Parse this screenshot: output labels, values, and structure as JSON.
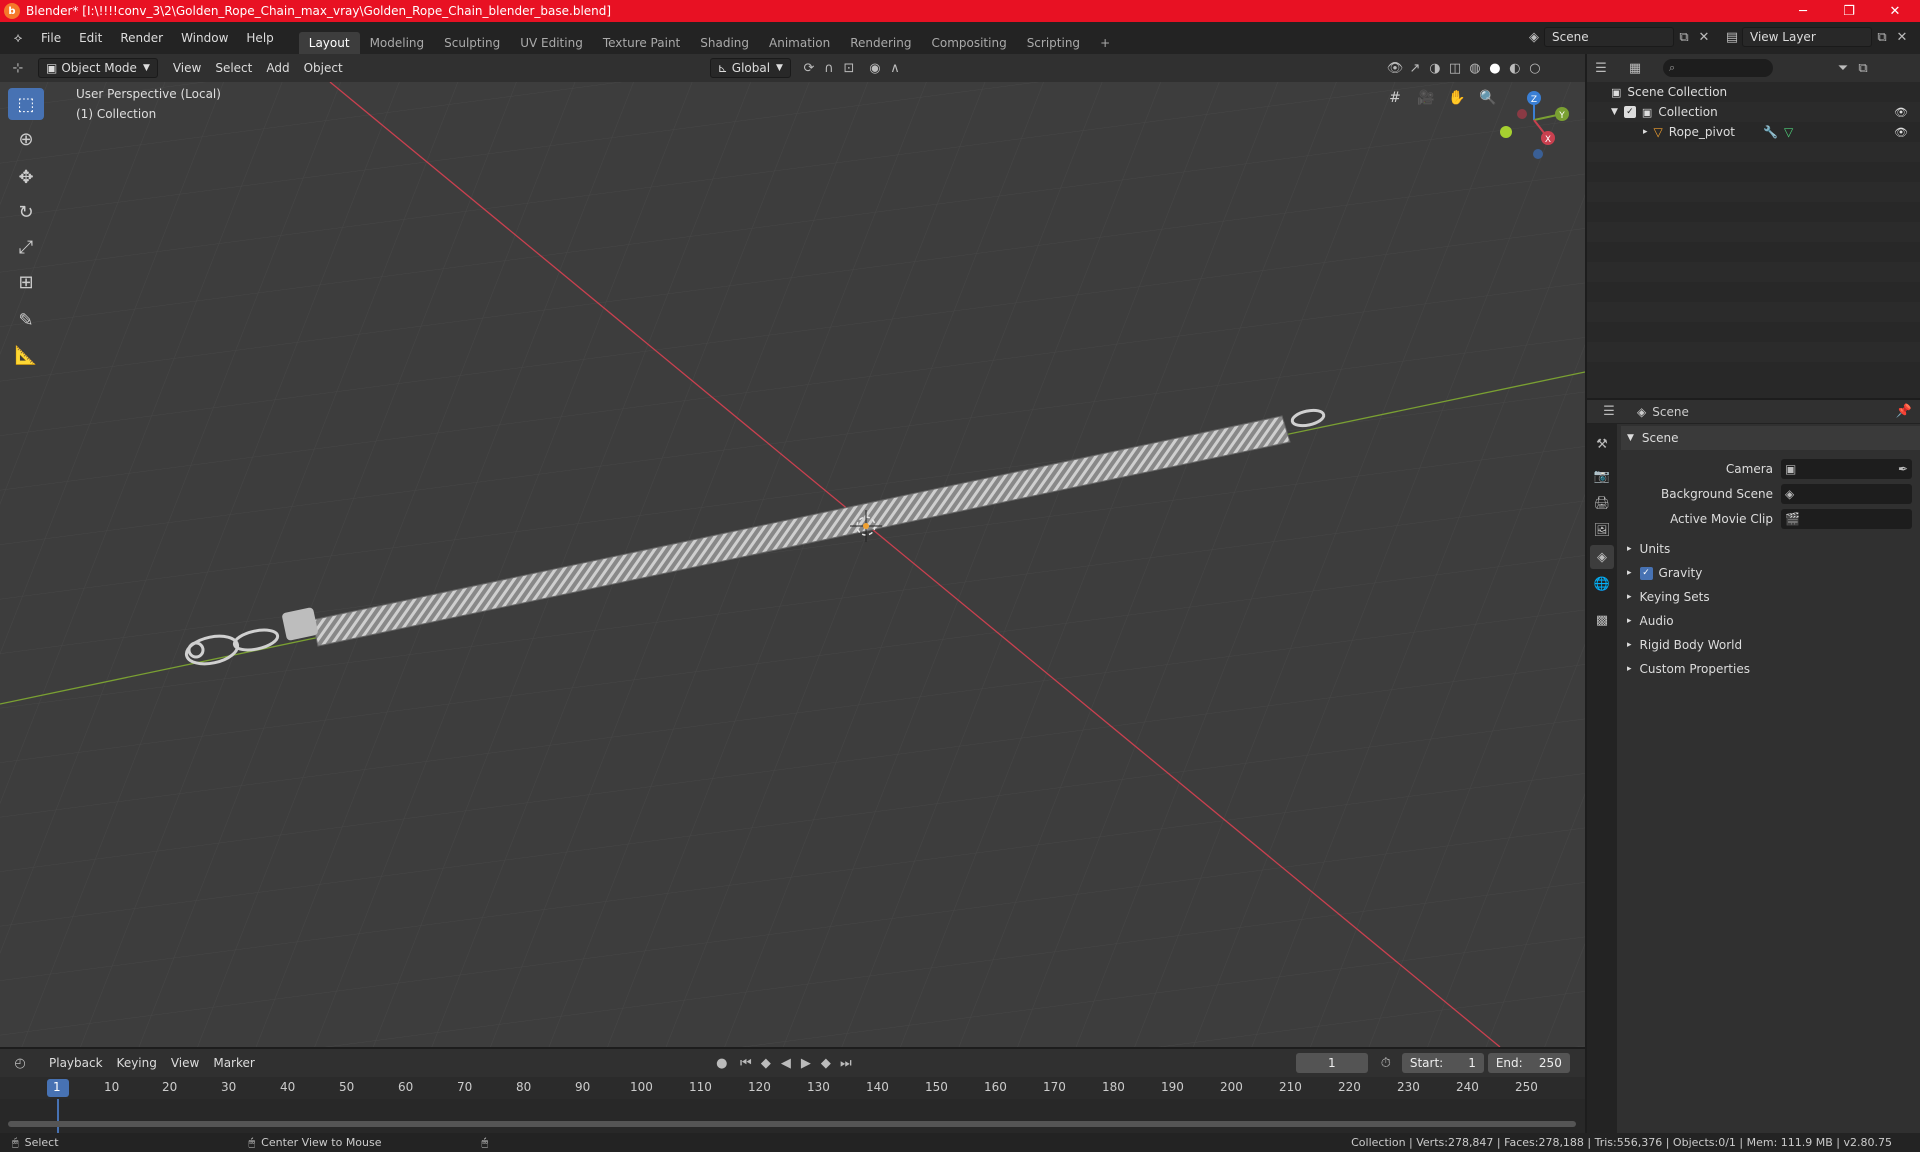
{
  "window": {
    "title": "Blender* [I:\\!!!!conv_3\\2\\Golden_Rope_Chain_max_vray\\Golden_Rope_Chain_blender_base.blend]",
    "controls": {
      "minimize": "─",
      "maximize": "❐",
      "close": "✕"
    }
  },
  "menu": {
    "items": [
      "File",
      "Edit",
      "Render",
      "Window",
      "Help"
    ]
  },
  "workspaces": {
    "tabs": [
      "Layout",
      "Modeling",
      "Sculpting",
      "UV Editing",
      "Texture Paint",
      "Shading",
      "Animation",
      "Rendering",
      "Compositing",
      "Scripting"
    ],
    "active": "Layout",
    "add": "+"
  },
  "scene_selector": {
    "value": "Scene"
  },
  "view_layer_selector": {
    "value": "View Layer"
  },
  "viewport": {
    "mode": "Object Mode",
    "menus": [
      "View",
      "Select",
      "Add",
      "Object"
    ],
    "transform_orientation": "Global",
    "info_line1": "User Perspective (Local)",
    "info_line2": "(1) Collection",
    "gizmo": {
      "x": "X",
      "y": "Y",
      "z": "Z"
    }
  },
  "outliner": {
    "search_placeholder": "",
    "root": "Scene Collection",
    "collection": "Collection",
    "object": "Rope_pivot"
  },
  "properties": {
    "header": "Scene",
    "section": "Scene",
    "fields": [
      {
        "label": "Camera",
        "value": ""
      },
      {
        "label": "Background Scene",
        "value": ""
      },
      {
        "label": "Active Movie Clip",
        "value": ""
      }
    ],
    "subsections": [
      "Units",
      "Gravity",
      "Keying Sets",
      "Audio",
      "Rigid Body World",
      "Custom Properties"
    ]
  },
  "timeline": {
    "menus": [
      "Playback",
      "Keying",
      "View",
      "Marker"
    ],
    "current_frame": "1",
    "start_label": "Start:",
    "start_value": "1",
    "end_label": "End:",
    "end_value": "250",
    "ruler": [
      "1",
      "10",
      "20",
      "30",
      "40",
      "50",
      "60",
      "70",
      "80",
      "90",
      "100",
      "110",
      "120",
      "130",
      "140",
      "150",
      "160",
      "170",
      "180",
      "190",
      "200",
      "210",
      "220",
      "230",
      "240",
      "250"
    ]
  },
  "statusbar": {
    "left": "Select",
    "middle": "Center View to Mouse",
    "right": "Collection | Verts:278,847 | Faces:278,188 | Tris:556,376 | Objects:0/1 | Mem: 111.9 MB | v2.80.75"
  },
  "colors": {
    "title_bar": "#e81123",
    "accent": "#4772b3",
    "x_axis": "#c9404f",
    "y_axis": "#7aa032"
  }
}
